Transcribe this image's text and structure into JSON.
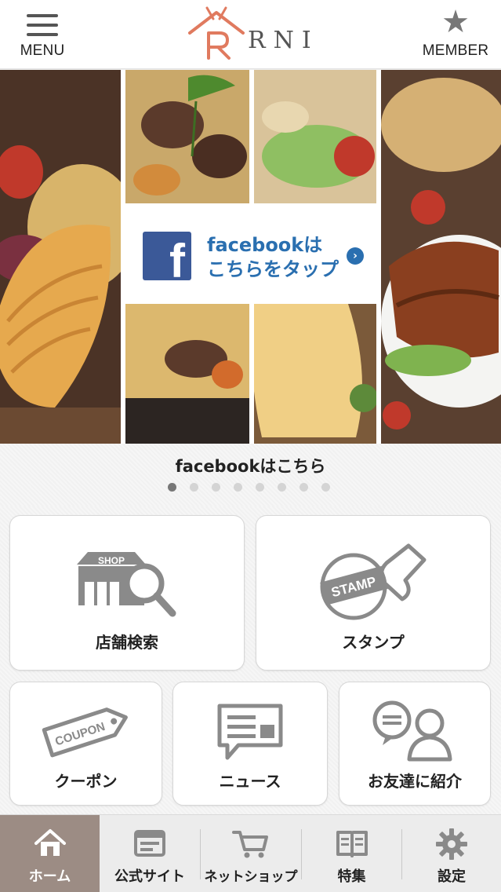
{
  "header": {
    "menu_label": "MENU",
    "logo_text": "RNI",
    "member_label": "MEMBER",
    "accent_color": "#e07a5f"
  },
  "banner": {
    "fb_line1": "facebookは",
    "fb_line2": "こちらをタップ",
    "fb_brand_color": "#3b5998",
    "caption": "facebookはこちら",
    "slide_count": 8,
    "active_slide": 1
  },
  "tiles": [
    {
      "name": "shop-search-tile",
      "label": "店舗検索",
      "icon": "shop-search-icon"
    },
    {
      "name": "stamp-tile",
      "label": "スタンプ",
      "icon": "stamp-icon"
    },
    {
      "name": "coupon-tile",
      "label": "クーポン",
      "icon": "coupon-icon"
    },
    {
      "name": "news-tile",
      "label": "ニュース",
      "icon": "news-icon"
    },
    {
      "name": "refer-friend-tile",
      "label": "お友達に紹介",
      "icon": "refer-friend-icon"
    }
  ],
  "icon_text": {
    "shop": "SHOP",
    "stamp": "STAMP",
    "coupon": "COUPON"
  },
  "tabbar": {
    "items": [
      {
        "label": "ホーム",
        "icon": "home-icon",
        "active": true
      },
      {
        "label": "公式サイト",
        "icon": "browser-icon",
        "active": false
      },
      {
        "label": "ネットショップ",
        "icon": "cart-icon",
        "active": false
      },
      {
        "label": "特集",
        "icon": "book-icon",
        "active": false
      },
      {
        "label": "設定",
        "icon": "gear-icon",
        "active": false
      }
    ],
    "active_color": "#9c8c84"
  }
}
